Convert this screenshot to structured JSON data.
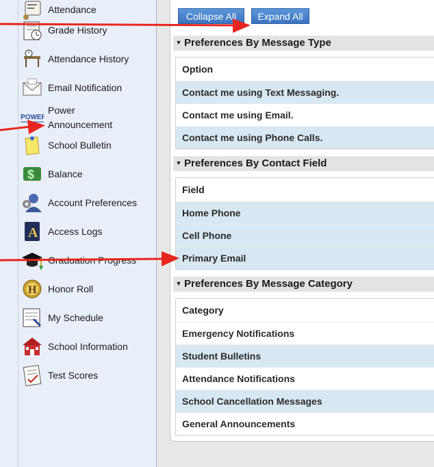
{
  "sidebar": {
    "items": [
      {
        "label": "Attendance",
        "icon": "attendance-icon"
      },
      {
        "label": "Grade History",
        "icon": "grade-history-icon"
      },
      {
        "label": "Attendance History",
        "icon": "attendance-history-icon"
      },
      {
        "label": "Email Notification",
        "icon": "email-icon"
      },
      {
        "label": "Power Announcement",
        "line1": "Power",
        "line2": "Announcement",
        "icon": "power-announcement-icon",
        "icon_text": "POWER"
      },
      {
        "label": "School Bulletin",
        "icon": "bulletin-icon"
      },
      {
        "label": "Balance",
        "icon": "balance-icon"
      },
      {
        "label": "Account Preferences",
        "icon": "account-preferences-icon"
      },
      {
        "label": "Access Logs",
        "icon": "access-logs-icon",
        "icon_text": "A"
      },
      {
        "label": "Graduation Progress",
        "icon": "graduation-cap-icon"
      },
      {
        "label": "Honor Roll",
        "icon": "honor-roll-icon",
        "icon_text": "H"
      },
      {
        "label": "My Schedule",
        "icon": "schedule-icon"
      },
      {
        "label": "School Information",
        "icon": "school-icon"
      },
      {
        "label": "Test Scores",
        "icon": "test-scores-icon"
      }
    ]
  },
  "toolbar": {
    "collapse_label": "Collapse All",
    "expand_label": "Expand All"
  },
  "sections": [
    {
      "title": "Preferences By Message Type",
      "header": "Option",
      "rows": [
        "Contact me using Text Messaging.",
        "Contact me using Email.",
        "Contact me using Phone Calls."
      ]
    },
    {
      "title": "Preferences By Contact Field",
      "header": "Field",
      "rows": [
        "Home Phone",
        "Cell Phone",
        "Primary Email"
      ]
    },
    {
      "title": "Preferences By Message Category",
      "header": "Category",
      "rows": [
        "Emergency Notifications",
        "Student Bulletins",
        "Attendance Notifications",
        "School Cancellation Messages",
        "General Announcements"
      ]
    }
  ],
  "colors": {
    "accent_button": "#3b74c0",
    "row_highlight": "#d8e8f2",
    "annotation_arrow": "#e8261f",
    "sidebar_bg": "#e9eff9"
  }
}
